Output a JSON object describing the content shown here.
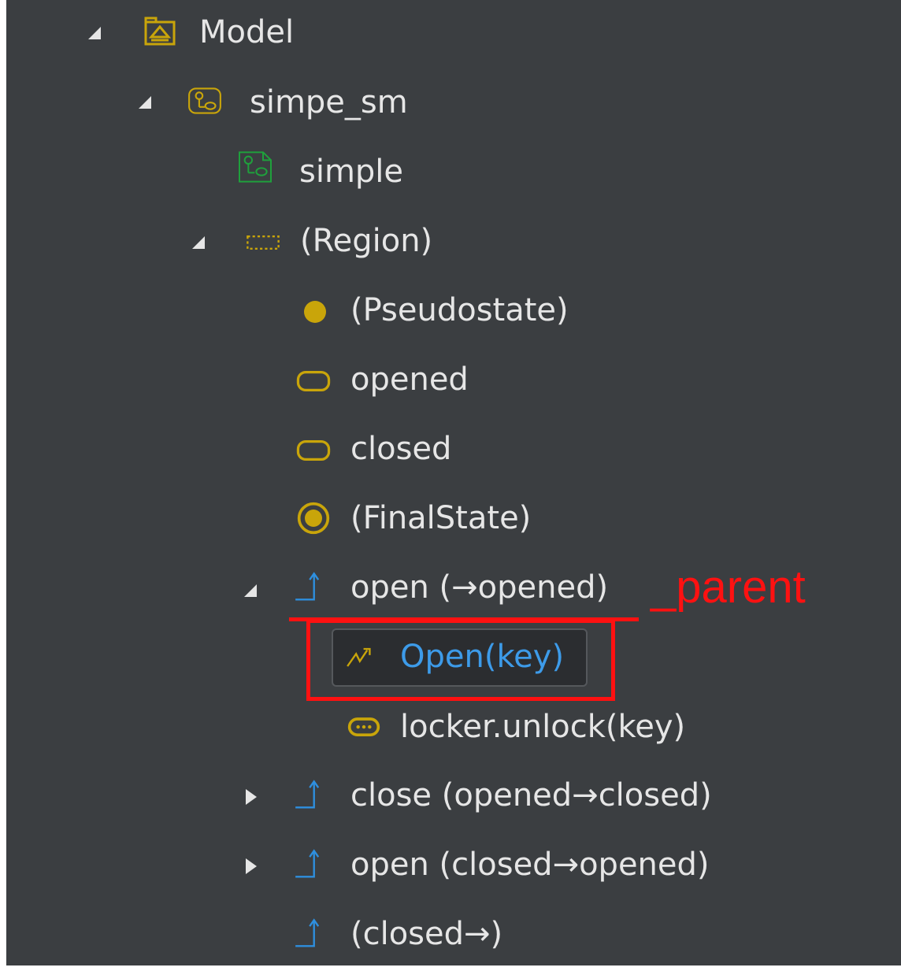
{
  "tree": {
    "items": [
      {
        "label": "Model",
        "icon": "model-package-icon"
      },
      {
        "label": "simpe_sm",
        "icon": "state-machine-icon"
      },
      {
        "label": "simple",
        "icon": "state-machine-diagram-icon"
      },
      {
        "label": "(Region)",
        "icon": "region-icon"
      },
      {
        "label": "(Pseudostate)",
        "icon": "initial-pseudostate-icon"
      },
      {
        "label": "opened",
        "icon": "state-icon"
      },
      {
        "label": "closed",
        "icon": "state-icon"
      },
      {
        "label": "(FinalState)",
        "icon": "final-state-icon"
      },
      {
        "label": "open (→opened)",
        "icon": "transition-icon"
      },
      {
        "label": "Open(key)",
        "icon": "trigger-icon"
      },
      {
        "label": "locker.unlock(key)",
        "icon": "behavior-icon"
      },
      {
        "label": "close (opened→closed)",
        "icon": "transition-icon"
      },
      {
        "label": "open (closed→opened)",
        "icon": "transition-icon"
      },
      {
        "label": "(closed→)",
        "icon": "transition-icon"
      }
    ]
  },
  "annotation": {
    "text": "_parent"
  },
  "colors": {
    "panel_background": "#3b3e41",
    "text": "#e6e6e6",
    "selected_text": "#3d9be9",
    "icon_gold": "#c9a50a",
    "icon_green": "#1fa03c",
    "icon_blue": "#2e8fde",
    "annotation_red": "#ff1111"
  }
}
